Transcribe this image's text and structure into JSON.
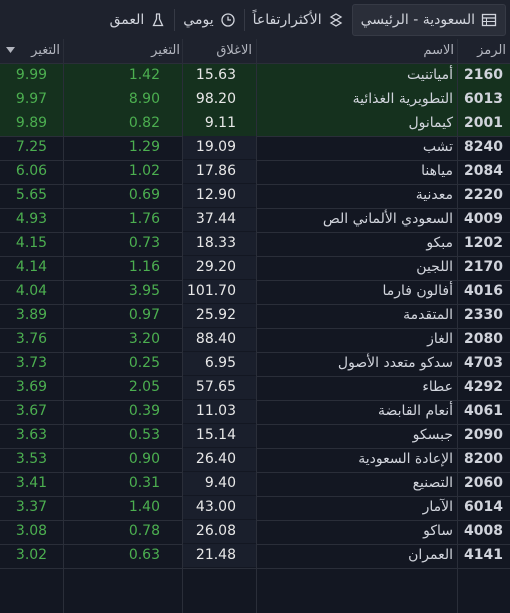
{
  "toolbar": {
    "market_label": "السعودية - الرئيسي",
    "filter_label": "الأكثرارتفاعاً",
    "period_label": "يومي",
    "column_label": "العمق"
  },
  "table": {
    "headers": {
      "symbol": "الرمز",
      "name": "الاسم",
      "close": "الاغلاق",
      "change": "التغير",
      "change_pct": "التغير"
    },
    "rows": [
      {
        "symbol": "2160",
        "name": "أمياتنيت",
        "close": "15.63",
        "change": "1.42",
        "pct": "9.99"
      },
      {
        "symbol": "6013",
        "name": "التطويرية الغذائية",
        "close": "98.20",
        "change": "8.90",
        "pct": "9.97"
      },
      {
        "symbol": "2001",
        "name": "كيمانول",
        "close": "9.11",
        "change": "0.82",
        "pct": "9.89"
      },
      {
        "symbol": "8240",
        "name": "تشب",
        "close": "19.09",
        "change": "1.29",
        "pct": "7.25"
      },
      {
        "symbol": "2084",
        "name": "مياهنا",
        "close": "17.86",
        "change": "1.02",
        "pct": "6.06"
      },
      {
        "symbol": "2220",
        "name": "معدنية",
        "close": "12.90",
        "change": "0.69",
        "pct": "5.65"
      },
      {
        "symbol": "4009",
        "name": "السعودي الألماني الص",
        "close": "37.44",
        "change": "1.76",
        "pct": "4.93"
      },
      {
        "symbol": "1202",
        "name": "مبكو",
        "close": "18.33",
        "change": "0.73",
        "pct": "4.15"
      },
      {
        "symbol": "2170",
        "name": "اللجين",
        "close": "29.20",
        "change": "1.16",
        "pct": "4.14"
      },
      {
        "symbol": "4016",
        "name": "أفالون فارما",
        "close": "101.70",
        "change": "3.95",
        "pct": "4.04"
      },
      {
        "symbol": "2330",
        "name": "المتقدمة",
        "close": "25.92",
        "change": "0.97",
        "pct": "3.89"
      },
      {
        "symbol": "2080",
        "name": "الغاز",
        "close": "88.40",
        "change": "3.20",
        "pct": "3.76"
      },
      {
        "symbol": "4703",
        "name": "سدكو متعدد الأصول",
        "close": "6.95",
        "change": "0.25",
        "pct": "3.73"
      },
      {
        "symbol": "4292",
        "name": "عطاء",
        "close": "57.65",
        "change": "2.05",
        "pct": "3.69"
      },
      {
        "symbol": "4061",
        "name": "أنعام القابضة",
        "close": "11.03",
        "change": "0.39",
        "pct": "3.67"
      },
      {
        "symbol": "2090",
        "name": "جبسكو",
        "close": "15.14",
        "change": "0.53",
        "pct": "3.63"
      },
      {
        "symbol": "8200",
        "name": "الإعادة السعودية",
        "close": "26.40",
        "change": "0.90",
        "pct": "3.53"
      },
      {
        "symbol": "2060",
        "name": "التصنيع",
        "close": "9.40",
        "change": "0.31",
        "pct": "3.41"
      },
      {
        "symbol": "6014",
        "name": "الآمار",
        "close": "43.00",
        "change": "1.40",
        "pct": "3.37"
      },
      {
        "symbol": "4008",
        "name": "ساكو",
        "close": "26.08",
        "change": "0.78",
        "pct": "3.08"
      },
      {
        "symbol": "4141",
        "name": "العمران",
        "close": "21.48",
        "change": "0.63",
        "pct": "3.02"
      }
    ]
  },
  "colors": {
    "positive": "#4caf50",
    "highlight_row": "#15311e",
    "background": "#131722"
  }
}
